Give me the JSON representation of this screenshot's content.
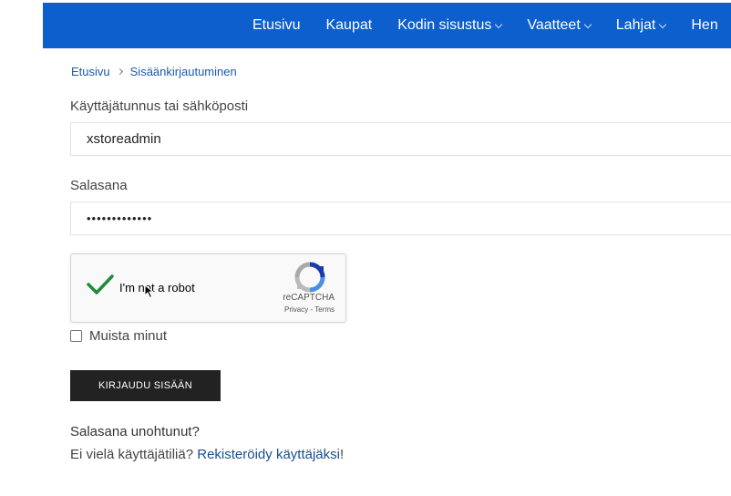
{
  "nav": {
    "items": [
      {
        "label": "Etusivu",
        "dropdown": false
      },
      {
        "label": "Kaupat",
        "dropdown": false
      },
      {
        "label": "Kodin sisustus",
        "dropdown": true
      },
      {
        "label": "Vaatteet",
        "dropdown": true
      },
      {
        "label": "Lahjat",
        "dropdown": true
      },
      {
        "label": "Hen",
        "dropdown": false
      }
    ]
  },
  "breadcrumb": {
    "home": "Etusivu",
    "current": "Sisäänkirjautuminen"
  },
  "form": {
    "username_label": "Käyttäjätunnus tai sähköposti",
    "username_value": "xstoreadmin",
    "password_label": "Salasana",
    "password_value": "•••••••••••••",
    "remember_label": "Muista minut",
    "submit_label": "KIRJAUDU SISÄÄN",
    "forgot_text": "Salasana unohtunut?",
    "no_account_text": "Ei vielä käyttäjätiliä?",
    "register_link": "Rekisteröidy käyttäjäksi",
    "register_suffix": "!"
  },
  "recaptcha": {
    "label": "I'm not a robot",
    "brand": "reCAPTCHA",
    "links": "Privacy - Terms",
    "checked": true
  },
  "colors": {
    "nav_bg": "#0c5fcd",
    "button_bg": "#222222",
    "link": "#1a5ba8",
    "check": "#1e8c3a"
  }
}
